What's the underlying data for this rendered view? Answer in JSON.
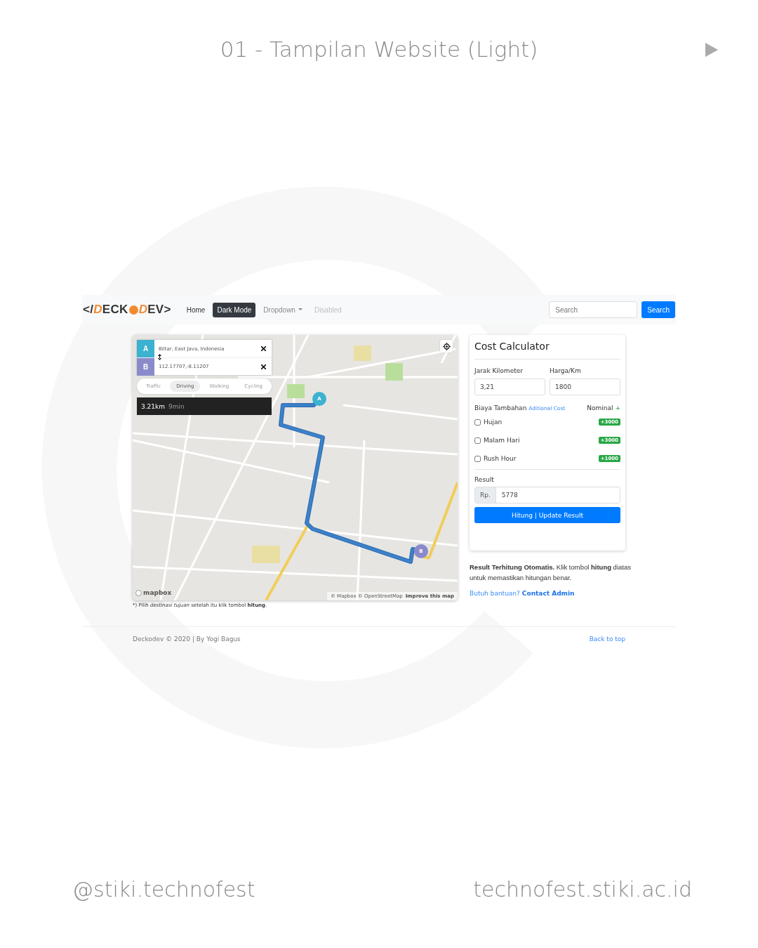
{
  "slide": {
    "title": "01 - Tampilan Website (Light)",
    "handle": "@stiki.technofest",
    "website": "technofest.stiki.ac.id"
  },
  "navbar": {
    "logo": [
      {
        "text": "</",
        "kind": "plain"
      },
      {
        "text": "D",
        "kind": "accent"
      },
      {
        "text": "ECK",
        "kind": "plain"
      },
      {
        "kind": "dot"
      },
      {
        "text": "D",
        "kind": "accent"
      },
      {
        "text": "EV>",
        "kind": "plain"
      }
    ],
    "links": [
      {
        "label": "Home",
        "kind": "link",
        "selected": false,
        "disabled": false
      },
      {
        "label": "Dark Mode",
        "kind": "link",
        "selected": true,
        "disabled": false
      },
      {
        "label": "Dropdown",
        "kind": "dropdown",
        "selected": false,
        "disabled": false
      },
      {
        "label": "Disabled",
        "kind": "link",
        "selected": false,
        "disabled": true
      }
    ],
    "search": {
      "placeholder": "Search",
      "button": "Search"
    }
  },
  "map": {
    "origin": {
      "marker": "A",
      "value": "Biltar, East Java, Indonesia"
    },
    "destination": {
      "marker": "B",
      "value": "112.17707,-8.11207"
    },
    "modes": [
      {
        "label": "Traffic",
        "selected": false
      },
      {
        "label": "Driving",
        "selected": true
      },
      {
        "label": "Walking",
        "selected": false
      },
      {
        "label": "Cycling",
        "selected": false
      }
    ],
    "summary": {
      "distance": "3.21km",
      "duration": "9min"
    },
    "route_markers": [
      "A",
      "B"
    ],
    "mapbox_logo": "mapbox",
    "attribution": "© Mapbox © OpenStreetMap",
    "improve": "Improve this map",
    "note": "*) Pilih *destinasi tujuan* setelah itu klik tombol **hitung**."
  },
  "calculator": {
    "title": "Cost Calculator",
    "fields": [
      {
        "label": "Jarak Kilometer",
        "value": "3,21"
      },
      {
        "label": "Harga/Km",
        "value": "1800"
      }
    ],
    "extra_label": "Biaya Tambahan",
    "extra_hint": "Aditional Cost",
    "nominal_label": "Nominal",
    "nominal_sign": "+",
    "options": [
      {
        "label": "Hujan",
        "checked": false,
        "badge": "+3000"
      },
      {
        "label": "Malam Hari",
        "checked": false,
        "badge": "+3000"
      },
      {
        "label": "Rush Hour",
        "checked": false,
        "badge": "+1000"
      }
    ],
    "result_label": "Result",
    "currency": "Rp.",
    "result": "5778",
    "button": "Hitung | Update Result",
    "info": "**Result Terhitung Otomatis.** Klik tombol **hitung** diatas untuk memastikan hitungan benar.",
    "help": "Butuh bantuan?",
    "help_link": "Contact Admin"
  },
  "footer": {
    "copyright": "Deckodev © 2020 | By Yogi Bagus",
    "back_to_top": "Back to top"
  }
}
